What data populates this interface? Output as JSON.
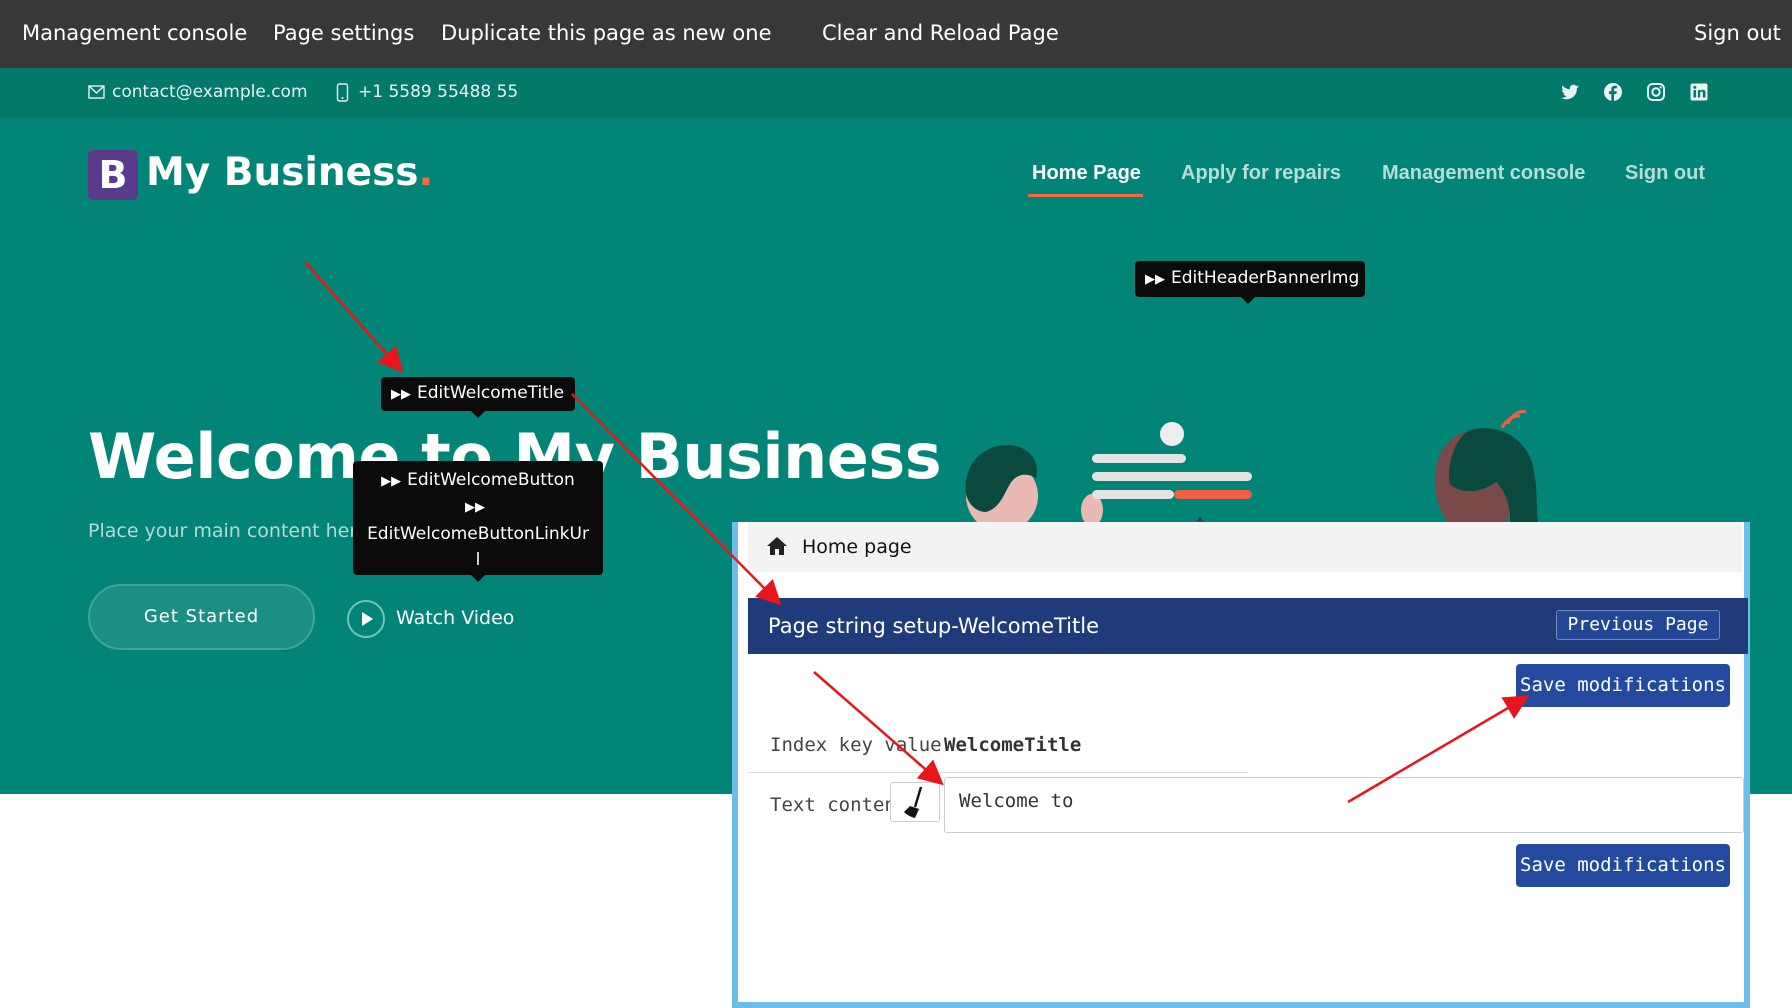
{
  "admin_bar": {
    "management_console": "Management console",
    "page_settings": "Page settings",
    "duplicate_page": "Duplicate this page as new one",
    "clear_reload": "Clear and Reload Page",
    "sign_out": "Sign out"
  },
  "topbar": {
    "email": "contact@example.com",
    "phone": "+1 5589 55488 55",
    "social_icons": [
      "twitter-icon",
      "facebook-icon",
      "instagram-icon",
      "linkedin-icon"
    ]
  },
  "header": {
    "logo_letter": "B",
    "brand_name": "My Business",
    "brand_dot": ".",
    "nav": [
      "Home Page",
      "Apply for repairs",
      "Management console",
      "Sign out"
    ],
    "active_nav": "Home Page"
  },
  "hero": {
    "title": "Welcome to My Business",
    "subtitle": "Place your main content here",
    "get_started": "Get Started",
    "watch_video": "Watch Video"
  },
  "tooltips": {
    "header_banner": "EditHeaderBannerImg",
    "welcome_title": "EditWelcomeTitle",
    "welcome_button": "EditWelcomeButton",
    "welcome_button_link_1": "EditWelcomeButtonLinkUr",
    "welcome_button_link_2": "l"
  },
  "panel": {
    "breadcrumb": "Home page",
    "header_title": "Page string setup-WelcomeTitle",
    "previous_page": "Previous Page",
    "save_label": "Save modifications",
    "index_key_label": "Index key value",
    "index_key_value": "WelcomeTitle",
    "text_content_label": "Text content",
    "text_content_value": "Welcome to"
  },
  "colors": {
    "admin_bar": "#383838",
    "topbar": "#03796a",
    "hero": "#028577",
    "accent": "#f26b47",
    "panel_header": "#1f3b7a",
    "save_button": "#234a9e",
    "annotation_arrow": "#e8151b"
  }
}
